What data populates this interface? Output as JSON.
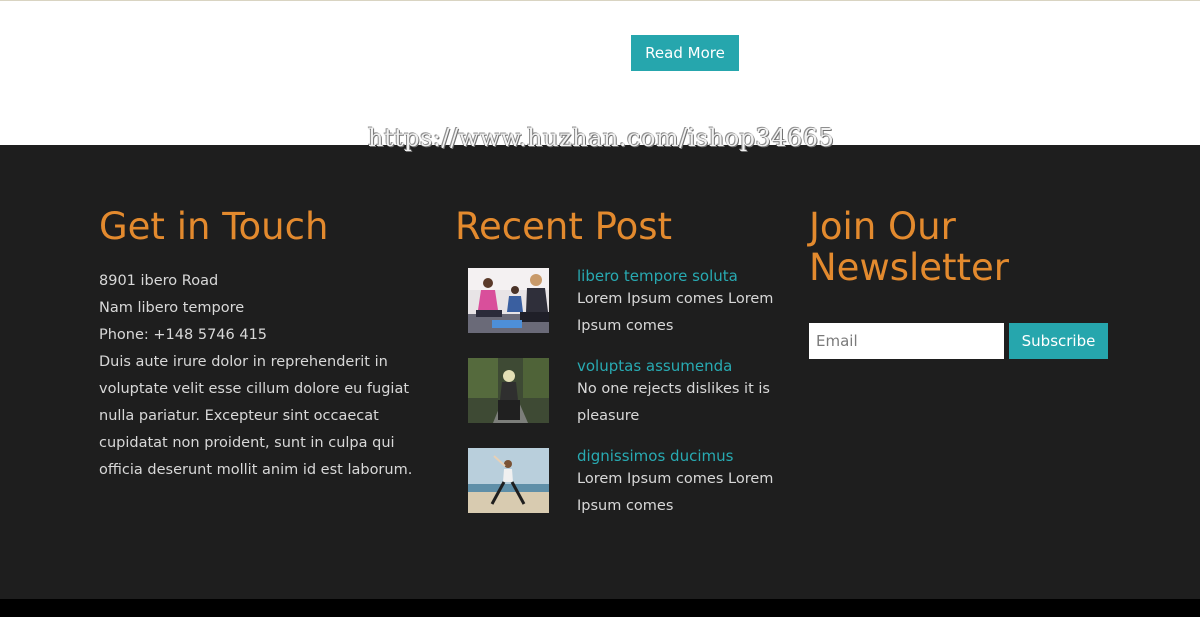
{
  "top": {
    "read_more_label": "Read More"
  },
  "watermark": "https://www.huzhan.com/ishop34665",
  "footer": {
    "contact": {
      "title": "Get in Touch",
      "address": "8901 ibero Road",
      "city": "Nam libero tempore",
      "phone": "Phone: +148 5746 415",
      "description": "Duis aute irure dolor in reprehenderit in voluptate velit esse cillum dolore eu fugiat nulla pariatur. Excepteur sint occaecat cupidatat non proident, sunt in culpa qui officia deserunt mollit anim id est laborum."
    },
    "recent": {
      "title": "Recent Post",
      "posts": [
        {
          "title": "libero tempore soluta",
          "excerpt": "Lorem Ipsum comes Lorem Ipsum comes",
          "image": "yoga-class-photo"
        },
        {
          "title": "voluptas assumenda",
          "excerpt": "No one rejects dislikes it is pleasure",
          "image": "meditation-road-photo"
        },
        {
          "title": "dignissimos ducimus",
          "excerpt": "Lorem Ipsum comes Lorem Ipsum comes",
          "image": "beach-yoga-photo"
        }
      ]
    },
    "newsletter": {
      "title": "Join Our Newsletter",
      "email_placeholder": "Email",
      "email_value": "",
      "subscribe_label": "Subscribe"
    }
  },
  "colors": {
    "accent_teal": "#26a6ad",
    "heading_orange": "#e38a2e",
    "footer_bg": "#1e1e1e",
    "text_light": "#d8d8d8"
  }
}
